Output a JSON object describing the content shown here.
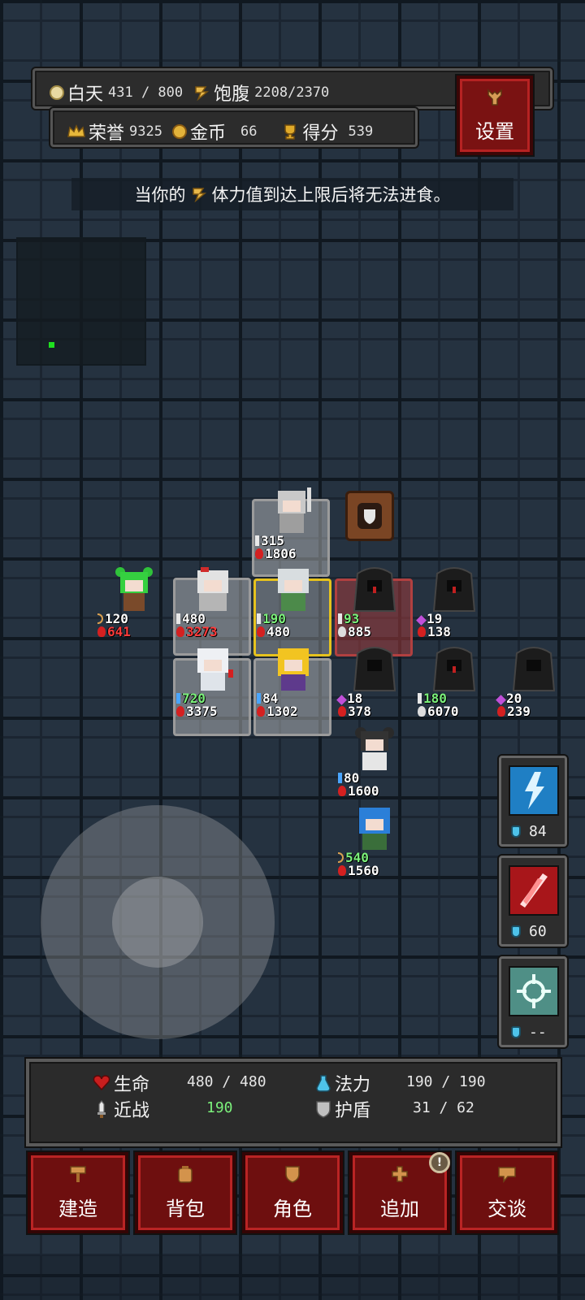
{
  "hud": {
    "day_label": "白天",
    "day_value": "431 / 800",
    "satiety_label": "饱腹",
    "satiety_value": "2208/2370",
    "honor_label": "荣誉",
    "honor_value": "9325",
    "gold_label": "金币",
    "gold_value": "66",
    "score_label": "得分",
    "score_value": "539",
    "settings_label": "设置"
  },
  "hint": {
    "prefix": "当你的",
    "suffix": "体力值到达上限后将无法进食。"
  },
  "units": [
    {
      "id": "knight-top",
      "atk": "315",
      "hp": "1806",
      "atk_icon": "sword-icon"
    },
    {
      "id": "green-archer",
      "atk": "120",
      "hp": "641",
      "atk_icon": "bow-icon",
      "hp_red": true
    },
    {
      "id": "white-knight",
      "atk": "480",
      "hp": "3273",
      "atk_icon": "sword-icon",
      "hp_red": true
    },
    {
      "id": "player",
      "atk": "190",
      "hp": "480",
      "atk_icon": "sword-icon",
      "atk_green": true
    },
    {
      "id": "reaper-1",
      "atk": "93",
      "hp": "885",
      "atk_icon": "sword-icon",
      "atk_green": true
    },
    {
      "id": "reaper-2",
      "atk": "19",
      "hp": "138",
      "atk_icon": "gem-icon"
    },
    {
      "id": "white-mage",
      "atk": "720",
      "hp": "3375",
      "atk_icon": "staff-icon",
      "atk_green": true
    },
    {
      "id": "blonde-mage",
      "atk": "84",
      "hp": "1302",
      "atk_icon": "staff-icon"
    },
    {
      "id": "reaper-3",
      "atk": "18",
      "hp": "378",
      "atk_icon": "gem-icon"
    },
    {
      "id": "reaper-4",
      "atk": "180",
      "hp": "6070",
      "atk_icon": "sword-icon",
      "atk_green": true
    },
    {
      "id": "reaper-5",
      "atk": "20",
      "hp": "239",
      "atk_icon": "gem-icon"
    },
    {
      "id": "twin-tail-girl",
      "atk": "80",
      "hp": "1600",
      "atk_icon": "staff-icon"
    },
    {
      "id": "blue-archer",
      "atk": "540",
      "hp": "1560",
      "atk_icon": "bow-icon",
      "atk_green": true
    }
  ],
  "skills": [
    {
      "name": "lightning-skill",
      "cost": "84"
    },
    {
      "name": "slash-skill",
      "cost": "60"
    },
    {
      "name": "target-skill",
      "cost": "--"
    }
  ],
  "stats": {
    "hp_label": "生命",
    "hp_value": "480 / 480",
    "mp_label": "法力",
    "mp_value": "190 / 190",
    "melee_label": "近战",
    "melee_value": "190",
    "shield_label": "护盾",
    "shield_value": "31 / 62"
  },
  "menu": {
    "build": "建造",
    "backpack": "背包",
    "character": "角色",
    "add": "追加",
    "talk": "交谈",
    "badge": "!"
  },
  "colors": {
    "button_red": "#6e0f0f",
    "health_red": "#ff3b3b",
    "attack_green": "#7bf07b",
    "minimap_player": "#1fe01f"
  }
}
